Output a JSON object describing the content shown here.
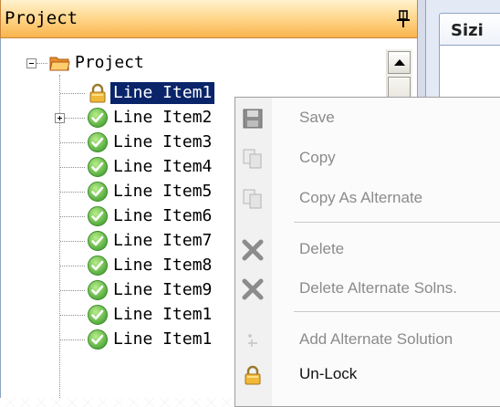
{
  "panel": {
    "title": "Project"
  },
  "tree": {
    "root": {
      "label": "Project"
    },
    "items": [
      {
        "label": "Line Item1",
        "icon": "lock-icon",
        "selected": true
      },
      {
        "label": "Line Item2",
        "icon": "check-icon",
        "expandable": true
      },
      {
        "label": "Line Item3",
        "icon": "check-icon"
      },
      {
        "label": "Line Item4",
        "icon": "check-icon"
      },
      {
        "label": "Line Item5",
        "icon": "check-icon"
      },
      {
        "label": "Line Item6",
        "icon": "check-icon"
      },
      {
        "label": "Line Item7",
        "icon": "check-icon"
      },
      {
        "label": "Line Item8",
        "icon": "check-icon"
      },
      {
        "label": "Line Item9",
        "icon": "check-icon"
      },
      {
        "label": "Line Item1",
        "icon": "check-icon"
      },
      {
        "label": "Line Item1",
        "icon": "check-icon"
      }
    ]
  },
  "right_panel": {
    "tab_label": "Sizi"
  },
  "context_menu": {
    "items": [
      {
        "label": "Save",
        "icon": "floppy-icon",
        "enabled": false
      },
      {
        "label": "Copy",
        "icon": "copy-icon",
        "enabled": false
      },
      {
        "label": "Copy As Alternate",
        "icon": "copy-alternate-icon",
        "enabled": false
      },
      {
        "label": "Delete",
        "icon": "delete-icon",
        "enabled": false
      },
      {
        "label": "Delete Alternate Solns.",
        "icon": "delete-alternate-icon",
        "enabled": false
      },
      {
        "label": "Add Alternate Solution",
        "icon": "add-alternate-icon",
        "enabled": false
      },
      {
        "label": "Un-Lock",
        "icon": "lock-icon",
        "enabled": true
      }
    ]
  },
  "colors": {
    "selection": "#0a246a",
    "header_orange": "#f9b44c",
    "check_green": "#4fa83a",
    "folder_orange": "#f0a64a"
  }
}
